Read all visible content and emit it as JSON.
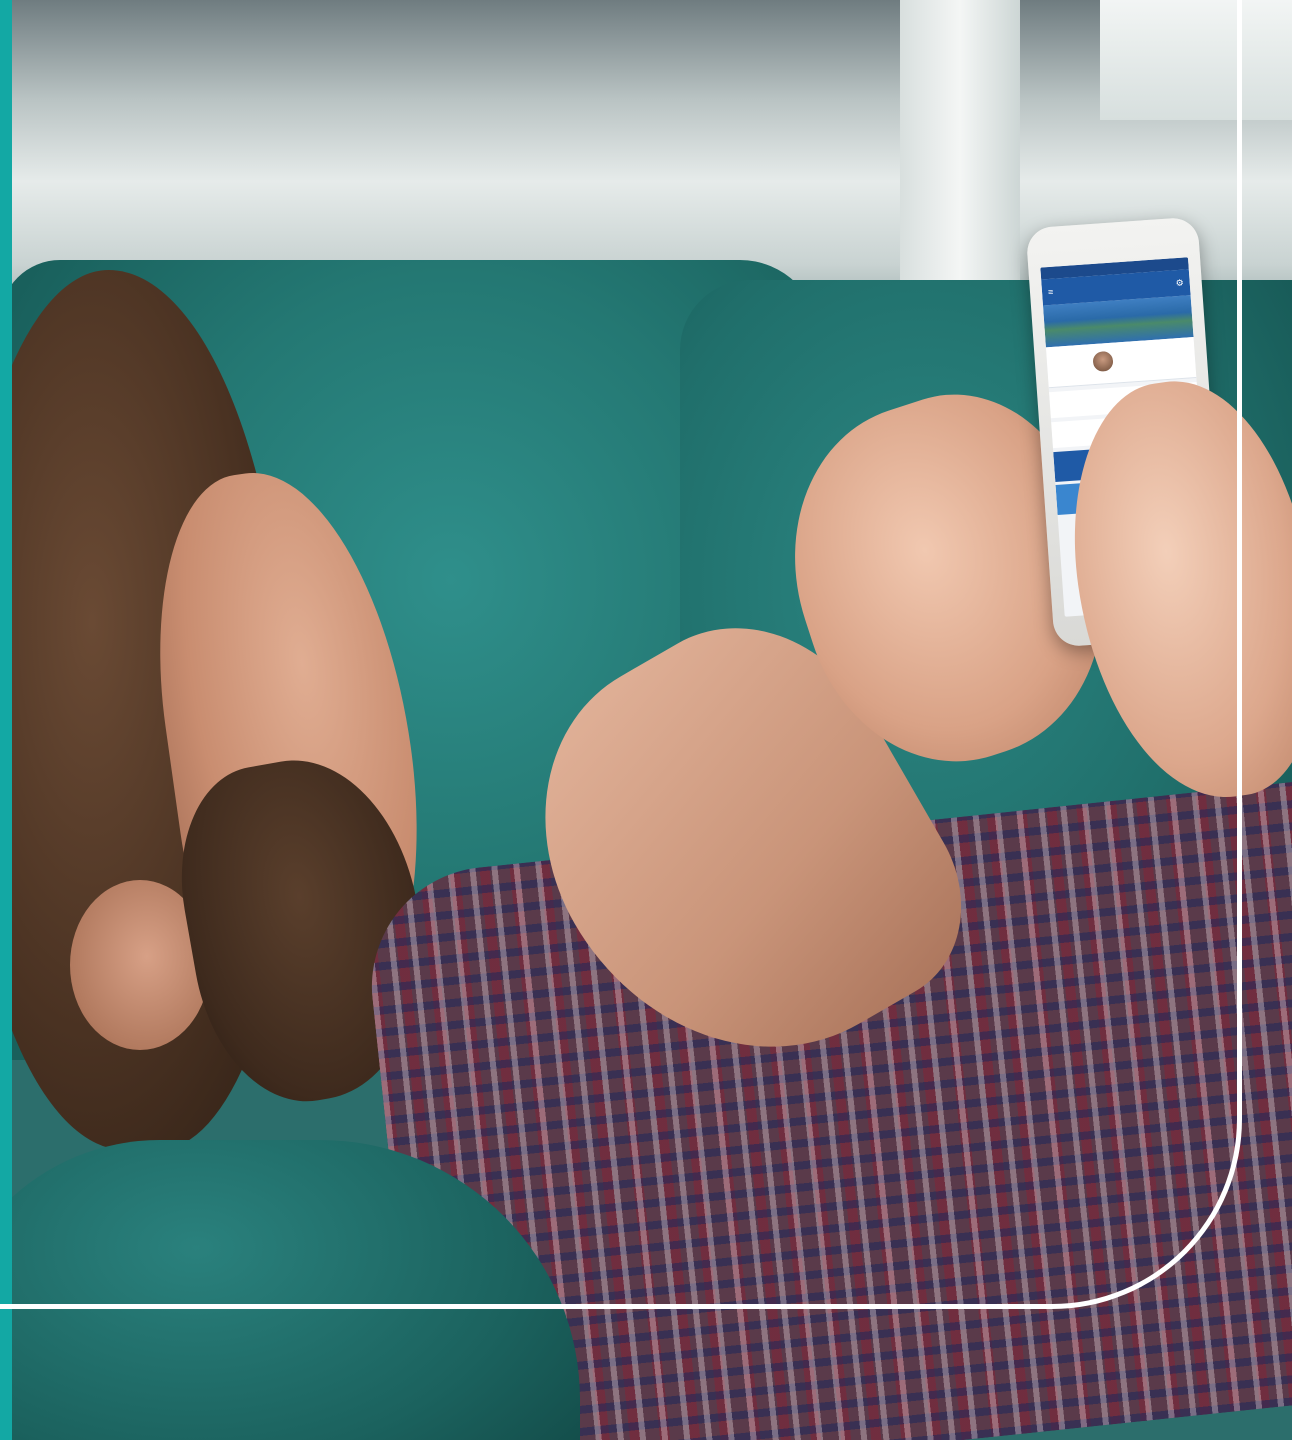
{
  "scene": {
    "subject": "man-lying-on-sofa-using-phone",
    "colors": {
      "accent_bar": "#13a8a4",
      "frame_line": "#ffffff",
      "sofa": "#247873",
      "app_primary": "#1f5aa6"
    }
  }
}
